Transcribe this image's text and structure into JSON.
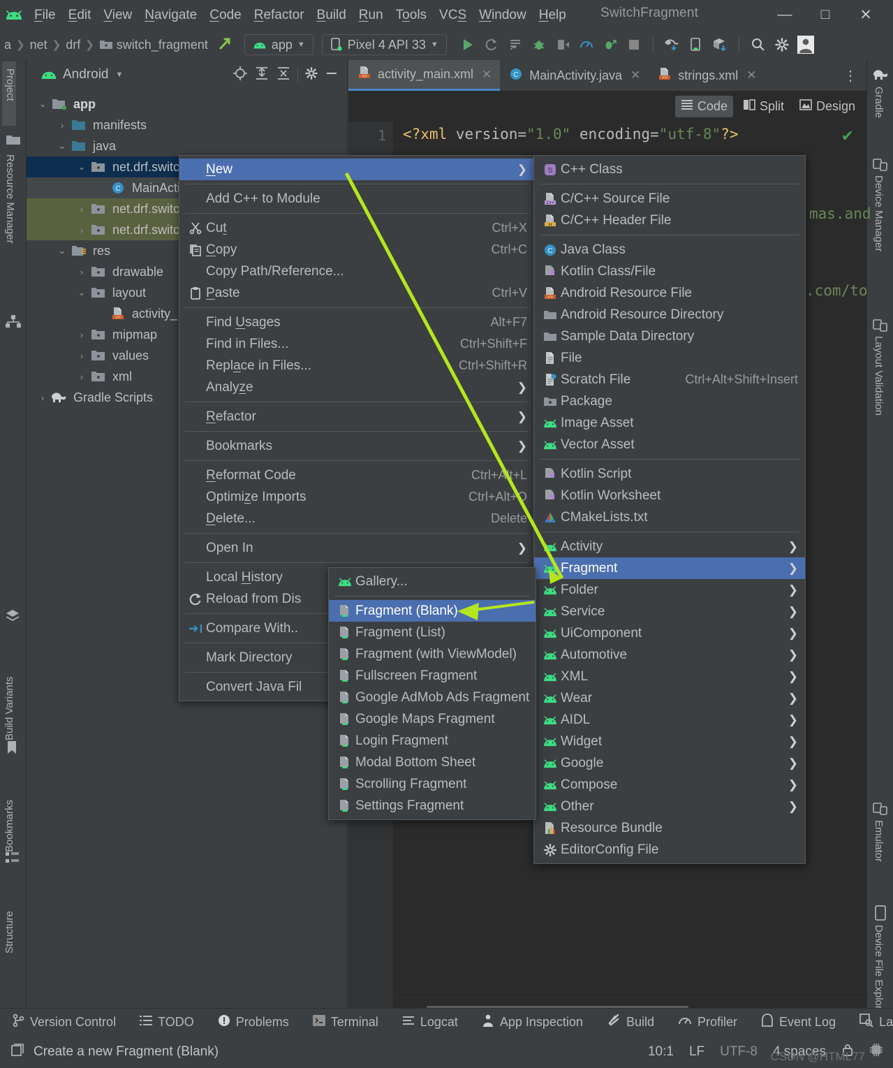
{
  "titlebar": {
    "menus": [
      "File",
      "Edit",
      "View",
      "Navigate",
      "Code",
      "Refactor",
      "Build",
      "Run",
      "Tools",
      "VCS",
      "Window",
      "Help"
    ],
    "project_title": "SwitchFragment",
    "minimize": "—",
    "maximize": "□",
    "close": "✕"
  },
  "navbar": {
    "breadcrumbs": [
      "a",
      "net",
      "drf",
      "switch_fragment"
    ],
    "module_selector": "app",
    "device_selector": "Pixel 4 API 33"
  },
  "left_strip": {
    "top": [
      "Project"
    ],
    "mid": [
      "Resource Manager"
    ],
    "bottom": [
      "Structure",
      "Bookmarks",
      "Build Variants"
    ]
  },
  "right_strip": {
    "top": [
      "Gradle",
      "Device Manager",
      "Layout Validation"
    ],
    "bottom": [
      "Emulator",
      "Device File Explorer"
    ]
  },
  "project_panel": {
    "title": "Android",
    "tree": [
      {
        "indent": 0,
        "arrow": "v",
        "icon": "module-folder",
        "label": "app",
        "bold": true,
        "state": "normal"
      },
      {
        "indent": 1,
        "arrow": ">",
        "icon": "folder-blue",
        "label": "manifests",
        "bold": false,
        "state": "normal"
      },
      {
        "indent": 1,
        "arrow": "v",
        "icon": "folder-blue",
        "label": "java",
        "bold": false,
        "state": "normal"
      },
      {
        "indent": 2,
        "arrow": "v",
        "icon": "package",
        "label": "net.drf.switc",
        "bold": false,
        "state": "sel-blue"
      },
      {
        "indent": 3,
        "arrow": "",
        "icon": "java-class",
        "label": "MainActi",
        "bold": false,
        "state": "sel-dark"
      },
      {
        "indent": 2,
        "arrow": ">",
        "icon": "package",
        "label": "net.drf.switc",
        "bold": false,
        "state": "sel-olive"
      },
      {
        "indent": 2,
        "arrow": ">",
        "icon": "package",
        "label": "net.drf.switc",
        "bold": false,
        "state": "sel-olive"
      },
      {
        "indent": 1,
        "arrow": "v",
        "icon": "res-folder",
        "label": "res",
        "bold": false,
        "state": "normal"
      },
      {
        "indent": 2,
        "arrow": ">",
        "icon": "package",
        "label": "drawable",
        "bold": false,
        "state": "normal"
      },
      {
        "indent": 2,
        "arrow": "v",
        "icon": "package",
        "label": "layout",
        "bold": false,
        "state": "normal"
      },
      {
        "indent": 3,
        "arrow": "",
        "icon": "xml-file",
        "label": "activity_",
        "bold": false,
        "state": "normal"
      },
      {
        "indent": 2,
        "arrow": ">",
        "icon": "package",
        "label": "mipmap",
        "bold": false,
        "state": "normal"
      },
      {
        "indent": 2,
        "arrow": ">",
        "icon": "package",
        "label": "values",
        "bold": false,
        "state": "normal"
      },
      {
        "indent": 2,
        "arrow": ">",
        "icon": "package",
        "label": "xml",
        "bold": false,
        "state": "normal"
      },
      {
        "indent": 0,
        "arrow": ">",
        "icon": "gradle",
        "label": "Gradle Scripts",
        "bold": false,
        "state": "normal"
      }
    ]
  },
  "editor": {
    "tabs": [
      {
        "label": "activity_main.xml",
        "icon": "xml-file",
        "active": true
      },
      {
        "label": "MainActivity.java",
        "icon": "java-class",
        "active": false
      },
      {
        "label": "strings.xml",
        "icon": "xml-file",
        "active": false
      }
    ],
    "overflow": "⋮",
    "view_modes": [
      "Code",
      "Split",
      "Design"
    ],
    "active_view_mode": "Code",
    "line_number": "1",
    "code_line_1": "<?xml version=\"1.0\" encoding=\"utf-8\"?>",
    "code_frag_1": "mas.and",
    "code_frag_2": ".com/to",
    "code_frag_3": "\""
  },
  "context_menu": {
    "items": [
      {
        "label": "New",
        "icon": "",
        "shortcut": "",
        "submenu": true,
        "selected": true,
        "underline": "N"
      },
      {
        "sep": true
      },
      {
        "label": "Add C++ to Module",
        "icon": "",
        "shortcut": "",
        "submenu": false
      },
      {
        "sep": true
      },
      {
        "label": "Cut",
        "icon": "scissors-icon",
        "shortcut": "Ctrl+X",
        "submenu": false,
        "underline": "t"
      },
      {
        "label": "Copy",
        "icon": "copy-icon",
        "shortcut": "Ctrl+C",
        "submenu": false,
        "underline": "C"
      },
      {
        "label": "Copy Path/Reference...",
        "icon": "",
        "shortcut": "",
        "submenu": false
      },
      {
        "label": "Paste",
        "icon": "clipboard-icon",
        "shortcut": "Ctrl+V",
        "submenu": false,
        "underline": "P"
      },
      {
        "sep": true
      },
      {
        "label": "Find Usages",
        "icon": "",
        "shortcut": "Alt+F7",
        "submenu": false,
        "underline": "U"
      },
      {
        "label": "Find in Files...",
        "icon": "",
        "shortcut": "Ctrl+Shift+F",
        "submenu": false
      },
      {
        "label": "Replace in Files...",
        "icon": "",
        "shortcut": "Ctrl+Shift+R",
        "submenu": false,
        "underline": "a"
      },
      {
        "label": "Analyze",
        "icon": "",
        "shortcut": "",
        "submenu": true,
        "underline": "z"
      },
      {
        "sep": true
      },
      {
        "label": "Refactor",
        "icon": "",
        "shortcut": "",
        "submenu": true,
        "underline": "R"
      },
      {
        "sep": true
      },
      {
        "label": "Bookmarks",
        "icon": "",
        "shortcut": "",
        "submenu": true
      },
      {
        "sep": true
      },
      {
        "label": "Reformat Code",
        "icon": "",
        "shortcut": "Ctrl+Alt+L",
        "submenu": false,
        "underline": "R"
      },
      {
        "label": "Optimize Imports",
        "icon": "",
        "shortcut": "Ctrl+Alt+O",
        "submenu": false,
        "underline": "z"
      },
      {
        "label": "Delete...",
        "icon": "",
        "shortcut": "Delete",
        "submenu": false,
        "underline": "D"
      },
      {
        "sep": true
      },
      {
        "label": "Open In",
        "icon": "",
        "shortcut": "",
        "submenu": true
      },
      {
        "sep": true
      },
      {
        "label": "Local History",
        "icon": "",
        "shortcut": "",
        "submenu": true,
        "underline": "H"
      },
      {
        "label": "Reload from Dis",
        "icon": "reload-icon",
        "shortcut": "",
        "submenu": false
      },
      {
        "sep": true
      },
      {
        "label": "Compare With..",
        "icon": "compare-icon",
        "shortcut": "",
        "submenu": false
      },
      {
        "sep": true
      },
      {
        "label": "Mark Directory ",
        "icon": "",
        "shortcut": "",
        "submenu": true
      },
      {
        "sep": true
      },
      {
        "label": "Convert Java Fil",
        "icon": "",
        "shortcut": "",
        "submenu": false
      }
    ]
  },
  "new_submenu": {
    "items": [
      {
        "label": "C++ Class",
        "icon": "cpp-class-icon",
        "shortcut": "",
        "submenu": false
      },
      {
        "sep": true
      },
      {
        "label": "C/C++ Source File",
        "icon": "cpp-source-icon",
        "shortcut": "",
        "submenu": false
      },
      {
        "label": "C/C++ Header File",
        "icon": "cpp-header-icon",
        "shortcut": "",
        "submenu": false
      },
      {
        "sep": true
      },
      {
        "label": "Java Class",
        "icon": "java-class-icon",
        "shortcut": "",
        "submenu": false
      },
      {
        "label": "Kotlin Class/File",
        "icon": "kotlin-icon",
        "shortcut": "",
        "submenu": false
      },
      {
        "label": "Android Resource File",
        "icon": "xml-file-icon",
        "shortcut": "",
        "submenu": false
      },
      {
        "label": "Android Resource Directory",
        "icon": "folder-icon",
        "shortcut": "",
        "submenu": false
      },
      {
        "label": "Sample Data Directory",
        "icon": "folder-icon",
        "shortcut": "",
        "submenu": false
      },
      {
        "label": "File",
        "icon": "file-icon",
        "shortcut": "",
        "submenu": false
      },
      {
        "label": "Scratch File",
        "icon": "scratch-file-icon",
        "shortcut": "Ctrl+Alt+Shift+Insert",
        "submenu": false
      },
      {
        "label": "Package",
        "icon": "package-icon",
        "shortcut": "",
        "submenu": false
      },
      {
        "label": "Image Asset",
        "icon": "android-icon",
        "shortcut": "",
        "submenu": false
      },
      {
        "label": "Vector Asset",
        "icon": "android-icon",
        "shortcut": "",
        "submenu": false
      },
      {
        "sep": true
      },
      {
        "label": "Kotlin Script",
        "icon": "kotlin-icon",
        "shortcut": "",
        "submenu": false
      },
      {
        "label": "Kotlin Worksheet",
        "icon": "kotlin-icon",
        "shortcut": "",
        "submenu": false
      },
      {
        "label": "CMakeLists.txt",
        "icon": "cmake-icon",
        "shortcut": "",
        "submenu": false
      },
      {
        "sep": true
      },
      {
        "label": "Activity",
        "icon": "android-icon",
        "shortcut": "",
        "submenu": true
      },
      {
        "label": "Fragment",
        "icon": "android-icon",
        "shortcut": "",
        "submenu": true,
        "selected": true
      },
      {
        "label": "Folder",
        "icon": "android-icon",
        "shortcut": "",
        "submenu": true
      },
      {
        "label": "Service",
        "icon": "android-icon",
        "shortcut": "",
        "submenu": true
      },
      {
        "label": "UiComponent",
        "icon": "android-icon",
        "shortcut": "",
        "submenu": true
      },
      {
        "label": "Automotive",
        "icon": "android-icon",
        "shortcut": "",
        "submenu": true
      },
      {
        "label": "XML",
        "icon": "android-icon",
        "shortcut": "",
        "submenu": true
      },
      {
        "label": "Wear",
        "icon": "android-icon",
        "shortcut": "",
        "submenu": true
      },
      {
        "label": "AIDL",
        "icon": "android-icon",
        "shortcut": "",
        "submenu": true
      },
      {
        "label": "Widget",
        "icon": "android-icon",
        "shortcut": "",
        "submenu": true
      },
      {
        "label": "Google",
        "icon": "android-icon",
        "shortcut": "",
        "submenu": true
      },
      {
        "label": "Compose",
        "icon": "android-icon",
        "shortcut": "",
        "submenu": true
      },
      {
        "label": "Other",
        "icon": "android-icon",
        "shortcut": "",
        "submenu": true
      },
      {
        "label": "Resource Bundle",
        "icon": "resource-bundle-icon",
        "shortcut": "",
        "submenu": false
      },
      {
        "label": "EditorConfig File",
        "icon": "gear-icon",
        "shortcut": "",
        "submenu": false
      }
    ]
  },
  "fragment_submenu": {
    "items": [
      {
        "label": "Gallery...",
        "icon": "android-icon",
        "submenu": false
      },
      {
        "sep": true
      },
      {
        "label": "Fragment (Blank)",
        "icon": "fragment-icon",
        "submenu": false,
        "selected": true
      },
      {
        "label": "Fragment (List)",
        "icon": "fragment-icon",
        "submenu": false
      },
      {
        "label": "Fragment (with ViewModel)",
        "icon": "fragment-icon",
        "submenu": false
      },
      {
        "label": "Fullscreen Fragment",
        "icon": "fragment-icon",
        "submenu": false
      },
      {
        "label": "Google AdMob Ads Fragment",
        "icon": "fragment-icon",
        "submenu": false
      },
      {
        "label": "Google Maps Fragment",
        "icon": "fragment-icon",
        "submenu": false
      },
      {
        "label": "Login Fragment",
        "icon": "fragment-icon",
        "submenu": false
      },
      {
        "label": "Modal Bottom Sheet",
        "icon": "fragment-icon",
        "submenu": false
      },
      {
        "label": "Scrolling Fragment",
        "icon": "fragment-icon",
        "submenu": false
      },
      {
        "label": "Settings Fragment",
        "icon": "fragment-icon",
        "submenu": false
      }
    ]
  },
  "tool_windows": [
    {
      "label": "Version Control",
      "icon": "branch-icon"
    },
    {
      "label": "TODO",
      "icon": "list-icon"
    },
    {
      "label": "Problems",
      "icon": "warning-icon"
    },
    {
      "label": "Terminal",
      "icon": "terminal-icon"
    },
    {
      "label": "Logcat",
      "icon": "logcat-icon"
    },
    {
      "label": "App Inspection",
      "icon": "inspection-icon"
    },
    {
      "label": "Build",
      "icon": "hammer-icon"
    },
    {
      "label": "Profiler",
      "icon": "profiler-icon"
    },
    {
      "label": "Event Log",
      "icon": "event-log-icon"
    },
    {
      "label": "Layout",
      "icon": "layout-icon"
    }
  ],
  "statusbar": {
    "message": "Create a new Fragment (Blank)",
    "caret_position": "10:1",
    "line_separator": "LF",
    "encoding": "UTF-8",
    "indent": "4 spaces",
    "watermark": "CSDN @HTML77"
  },
  "colors": {
    "accent_selection": "#4b6eaf",
    "android_green": "#3ddc84",
    "arrow_annotation": "#b5e61d",
    "background": "#3c3f41",
    "editor_background": "#2b2b2b"
  }
}
